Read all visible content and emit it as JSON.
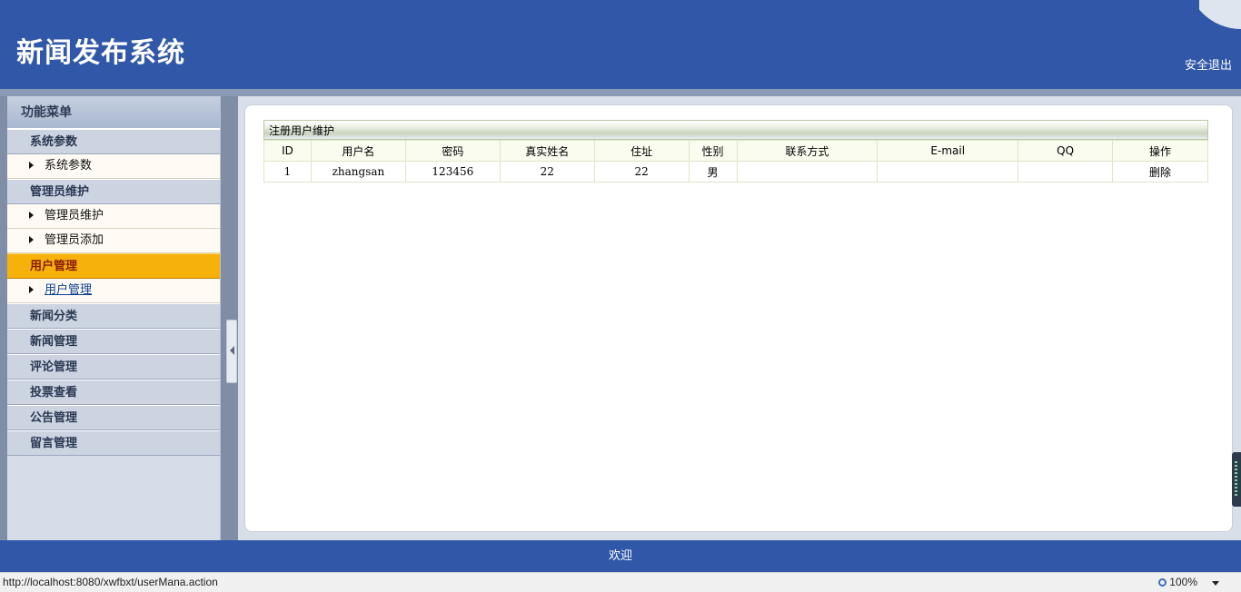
{
  "header": {
    "title": "新闻发布系统",
    "logout_label": "安全退出"
  },
  "sidebar": {
    "menu_title": "功能菜单",
    "groups": [
      {
        "label": "系统参数",
        "items": [
          "系统参数"
        ]
      },
      {
        "label": "管理员维护",
        "items": [
          "管理员维护",
          "管理员添加"
        ]
      },
      {
        "label": "用户管理",
        "items": [
          "用户管理"
        ],
        "active": true
      },
      {
        "label": "新闻分类"
      },
      {
        "label": "新闻管理"
      },
      {
        "label": "评论管理"
      },
      {
        "label": "投票查看"
      },
      {
        "label": "公告管理"
      },
      {
        "label": "留言管理"
      }
    ]
  },
  "main": {
    "panel_title": "注册用户维护",
    "table": {
      "columns": [
        "ID",
        "用户名",
        "密码",
        "真实姓名",
        "住址",
        "性别",
        "联系方式",
        "E-mail",
        "QQ",
        "操作"
      ],
      "rows": [
        {
          "id": "1",
          "username": "zhangsan",
          "password": "123456",
          "realname": "22",
          "address": "22",
          "gender": "男",
          "contact": "",
          "email": "",
          "qq": "",
          "action": "删除"
        }
      ]
    }
  },
  "footer": {
    "text": "欢迎"
  },
  "statusbar": {
    "url": "http://localhost:8080/xwfbxt/userMana.action",
    "zoom": "100%"
  },
  "colors": {
    "header_bg": "#3158a8",
    "active_menu": "#f6b10a"
  }
}
